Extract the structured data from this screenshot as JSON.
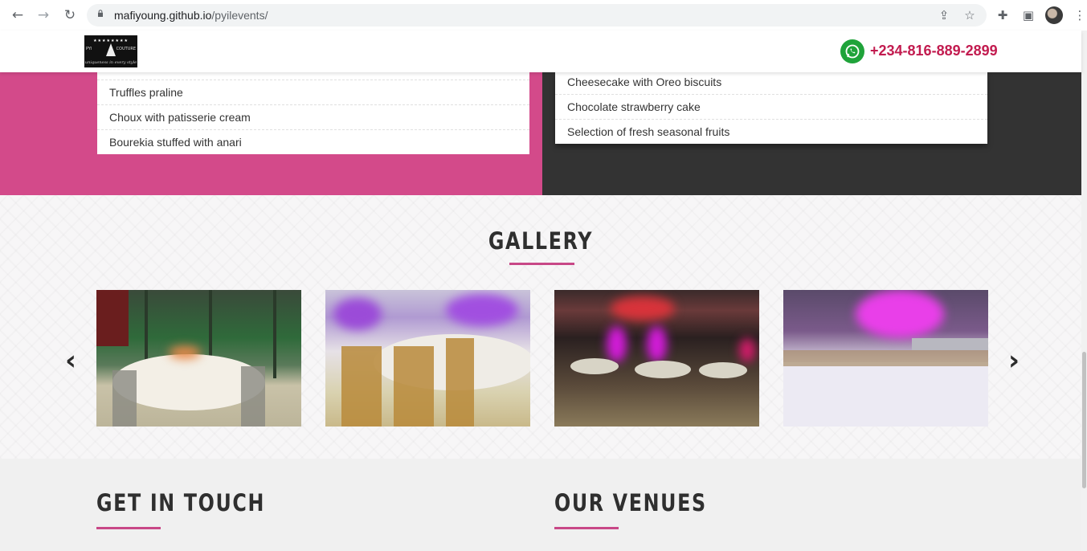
{
  "browser": {
    "url_host": "mafiyoung.github.io",
    "url_path": "/pyilevents/",
    "icons": [
      "back-icon",
      "forward-icon",
      "reload-icon",
      "lock-icon",
      "share-icon",
      "star-icon",
      "extensions-icon",
      "sidepanel-icon",
      "profile-avatar",
      "menu-dots-icon"
    ]
  },
  "header": {
    "phone": "+234-816-889-2899",
    "logo_top": "PYI",
    "logo_right": "COUTURE",
    "logo_tag": "uniqueness in every style",
    "accent_color": "#c21b4f"
  },
  "menu": {
    "left_items": [
      "Truffles praline",
      "Choux with patisserie cream",
      "Bourekia stuffed with anari"
    ],
    "right_items": [
      "Cheesecake with Oreo biscuits",
      "Chocolate strawberry cake",
      "Selection of fresh seasonal fruits"
    ],
    "left_bg": "#d34a8a",
    "right_bg": "#333333"
  },
  "gallery": {
    "title": "GALLERY",
    "prev_icon": "‹",
    "next_icon": "›",
    "photos": [
      "dining-tables-garden",
      "golden-chairs-purple-lights",
      "banquet-hall-magenta",
      "buffet-table-lights"
    ]
  },
  "footer": {
    "get_in_touch": "GET IN TOUCH",
    "our_venues": "OUR VENUES",
    "underline_color": "#c84887"
  }
}
